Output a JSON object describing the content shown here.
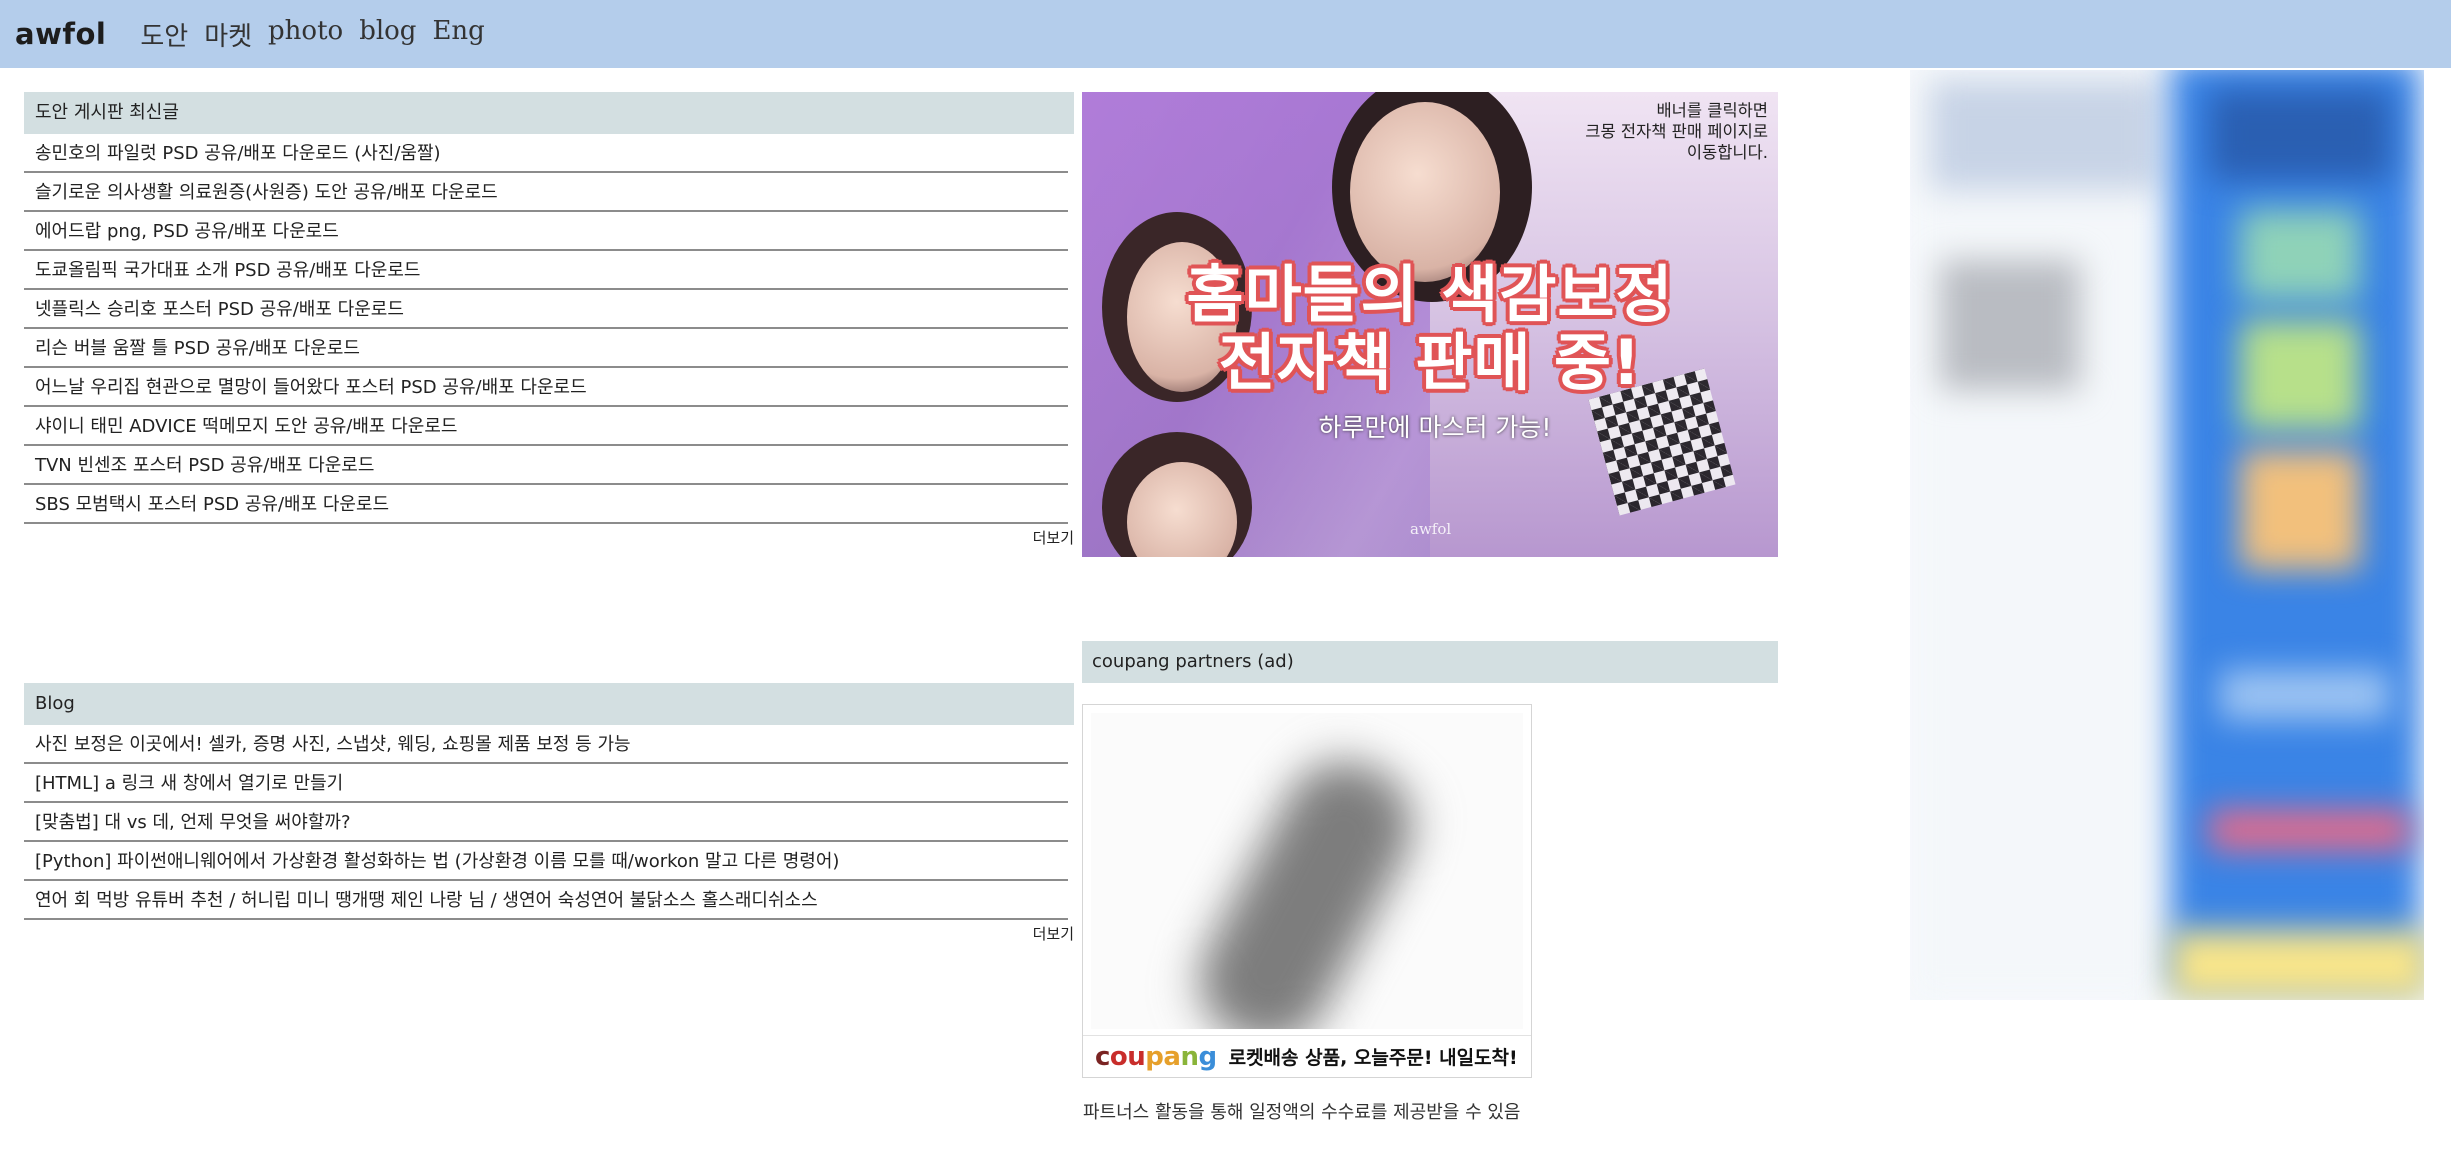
{
  "header": {
    "logo": "awfol",
    "nav": [
      "도안",
      "마켓",
      "photo",
      "blog",
      "Eng"
    ]
  },
  "board_doan": {
    "title": "도안 게시판 최신글",
    "items": [
      "송민호의 파일럿 PSD 공유/배포 다운로드 (사진/움짤)",
      "슬기로운 의사생활 의료원증(사원증) 도안 공유/배포 다운로드",
      "에어드랍 png, PSD 공유/배포 다운로드",
      "도쿄올림픽 국가대표 소개 PSD 공유/배포 다운로드",
      "넷플릭스 승리호 포스터 PSD 공유/배포 다운로드",
      "리슨 버블 움짤 틀 PSD 공유/배포 다운로드",
      "어느날 우리집 현관으로 멸망이 들어왔다 포스터 PSD 공유/배포 다운로드",
      "샤이니 태민 ADVICE 떡메모지 도안 공유/배포 다운로드",
      "TVN 빈센조 포스터 PSD 공유/배포 다운로드",
      "SBS 모범택시 포스터 PSD 공유/배포 다운로드"
    ],
    "more": "더보기"
  },
  "board_blog": {
    "title": "Blog",
    "items": [
      "사진 보정은 이곳에서! 셀카, 증명 사진, 스냅샷, 웨딩, 쇼핑몰 제품 보정 등 가능",
      "[HTML] a 링크 새 창에서 열기로 만들기",
      "[맞춤법] 대 vs 데, 언제 무엇을 써야할까?",
      "[Python] 파이썬애니웨어에서 가상환경 활성화하는 법 (가상환경 이름 모를 때/workon 말고 다른 명령어)",
      "연어 회 먹방 유튜버 추천 / 허니립 미니 땡개땡 제인 나랑 님 / 생연어 숙성연어 불닭소스 홀스래디쉬소스"
    ],
    "more": "더보기"
  },
  "banner": {
    "note_lines": [
      "배너를 클릭하면",
      "크몽 전자책 판매 페이지로",
      "이동합니다."
    ],
    "headline_1": "홈마들의 색감보정",
    "headline_2": "전자책 판매 중!",
    "subline": "하루만에 마스터 가능!",
    "watermark": "awfol"
  },
  "coupang": {
    "header": "coupang partners (ad)",
    "logo_parts": [
      "c",
      "ou",
      "pa",
      "n",
      "g"
    ],
    "tagline": "로켓배송 상품, 오늘주문! 내일도착!",
    "disclosure": "파트너스 활동을 통해 일정액의 수수료를 제공받을 수 있음"
  },
  "colors": {
    "topbar": "#b4cdeb",
    "panel_header": "#d3dfe1",
    "banner_outline": "#e05456"
  }
}
